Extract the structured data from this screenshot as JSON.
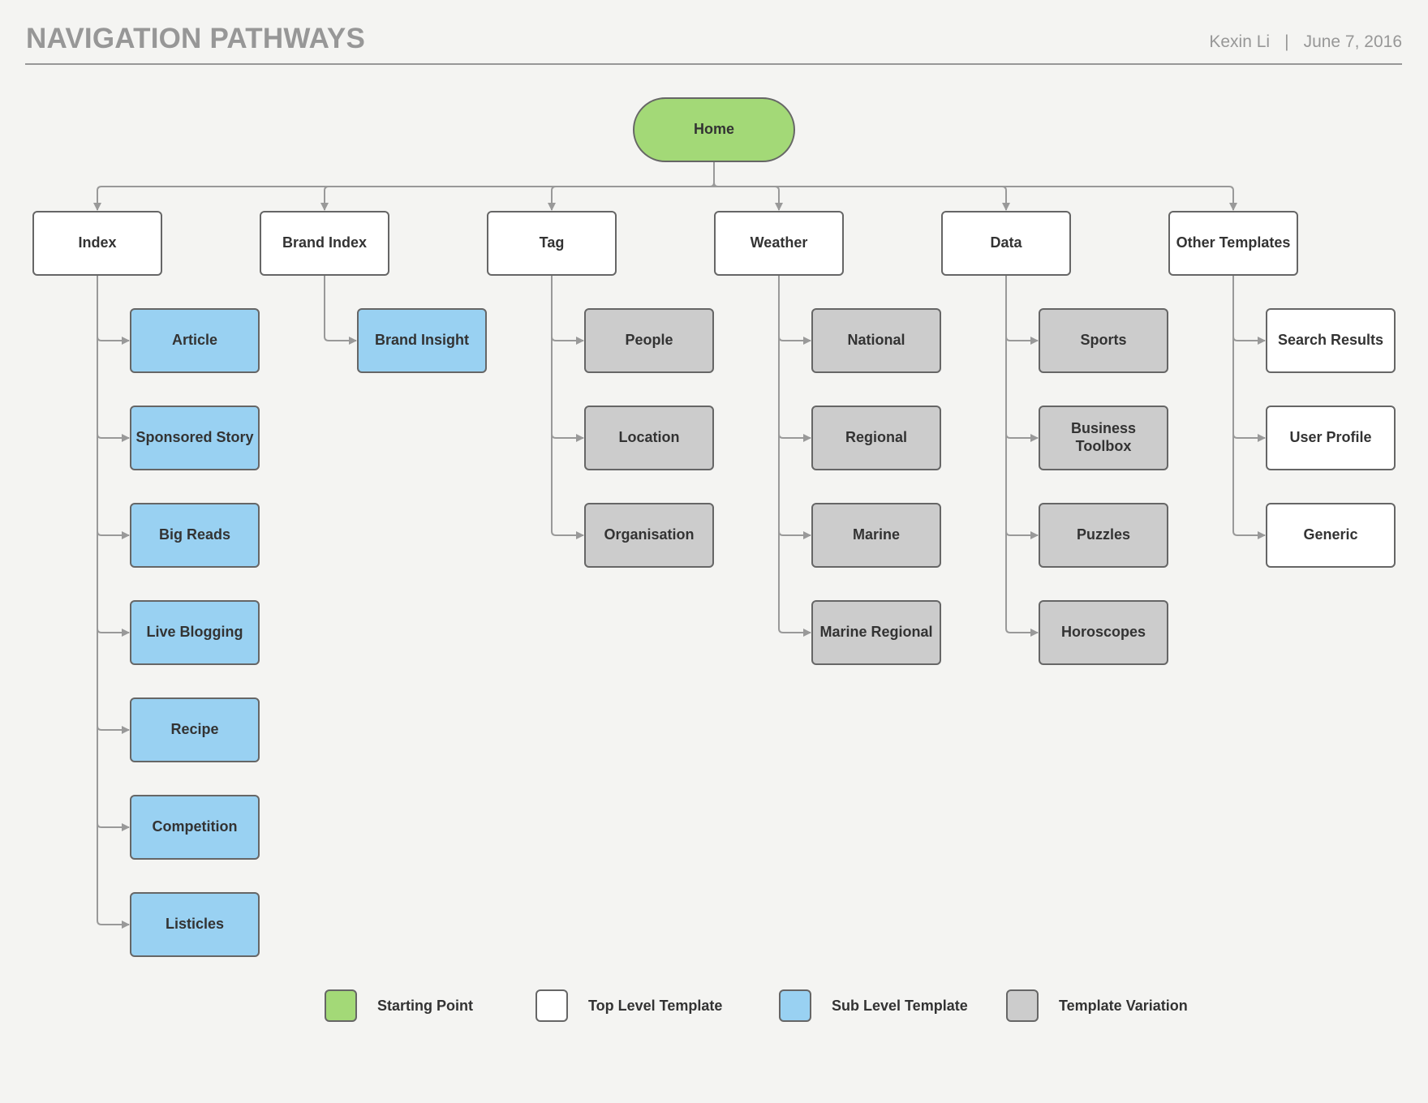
{
  "header": {
    "title": "NAVIGATION PATHWAYS",
    "author": "Kexin Li",
    "separator": "|",
    "date": "June 7, 2016"
  },
  "colors": {
    "starting_point": "#a3d977",
    "top_level": "#ffffff",
    "sub_level": "#99d1f2",
    "variation": "#cccccc",
    "connector": "#999999",
    "border": "#666666"
  },
  "root": {
    "label": "Home",
    "type": "start"
  },
  "columns": [
    {
      "label": "Index",
      "type": "top",
      "children": [
        {
          "label": "Article",
          "type": "sub"
        },
        {
          "label": "Sponsored Story",
          "type": "sub"
        },
        {
          "label": "Big Reads",
          "type": "sub"
        },
        {
          "label": "Live Blogging",
          "type": "sub"
        },
        {
          "label": "Recipe",
          "type": "sub"
        },
        {
          "label": "Competition",
          "type": "sub"
        },
        {
          "label": "Listicles",
          "type": "sub"
        }
      ]
    },
    {
      "label": "Brand Index",
      "type": "top",
      "children": [
        {
          "label": "Brand Insight",
          "type": "sub"
        }
      ]
    },
    {
      "label": "Tag",
      "type": "top",
      "children": [
        {
          "label": "People",
          "type": "var"
        },
        {
          "label": "Location",
          "type": "var"
        },
        {
          "label": "Organisation",
          "type": "var"
        }
      ]
    },
    {
      "label": "Weather",
      "type": "top",
      "children": [
        {
          "label": "National",
          "type": "var"
        },
        {
          "label": "Regional",
          "type": "var"
        },
        {
          "label": "Marine",
          "type": "var"
        },
        {
          "label": "Marine Regional",
          "type": "var"
        }
      ]
    },
    {
      "label": "Data",
      "type": "top",
      "children": [
        {
          "label": "Sports",
          "type": "var"
        },
        {
          "label": "Business Toolbox",
          "type": "var"
        },
        {
          "label": "Puzzles",
          "type": "var"
        },
        {
          "label": "Horoscopes",
          "type": "var"
        }
      ]
    },
    {
      "label": "Other Templates",
      "type": "top",
      "children": [
        {
          "label": "Search Results",
          "type": "top"
        },
        {
          "label": "User Profile",
          "type": "top"
        },
        {
          "label": "Generic",
          "type": "top"
        }
      ]
    }
  ],
  "legend": [
    {
      "label": "Starting Point",
      "type": "start"
    },
    {
      "label": "Top Level Template",
      "type": "top"
    },
    {
      "label": "Sub Level Template",
      "type": "sub"
    },
    {
      "label": "Template Variation",
      "type": "var"
    }
  ]
}
